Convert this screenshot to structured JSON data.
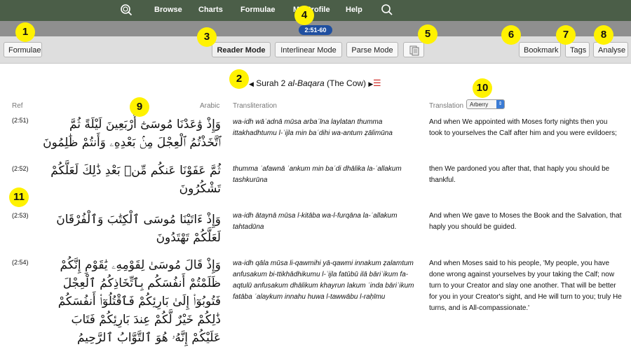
{
  "nav": {
    "items": [
      "Browse",
      "Charts",
      "Formulae",
      "My Profile",
      "Help"
    ],
    "verse_range": "2:51-60"
  },
  "toolbar": {
    "formulae": "Formulae",
    "reader_mode": "Reader Mode",
    "interlinear_mode": "Interlinear Mode",
    "parse_mode": "Parse Mode",
    "bookmark": "Bookmark",
    "tags": "Tags",
    "analyse": "Analyse"
  },
  "markers": [
    "1",
    "2",
    "3",
    "4",
    "5",
    "6",
    "7",
    "8",
    "9",
    "10",
    "11"
  ],
  "surah": {
    "prefix": "Surah 2",
    "name": "al-Baqara",
    "english": "(The Cow)"
  },
  "columns": {
    "ref": "Ref",
    "arabic": "Arabic",
    "transliteration": "Transliteration",
    "translation": "Translation"
  },
  "translator": "Arberry",
  "verses": [
    {
      "ref": "(2:51)",
      "arabic": "وَإِذْ وَٰعَدْنَا مُوسَىٰٓ أَرْبَعِينَ لَيْلَةً ثُمَّ ٱتَّخَذْتُمُ ٱلْعِجْلَ مِنۢ بَعْدِهِۦ وَأَنتُمْ ظَٰلِمُونَ",
      "translit": "wa-idh wāʿadnā mūsa arbaʿīna laylatan thumma ittakhadhtumu l-ʿijla min baʿdihi wa-antum ẓālimūna",
      "translation": "And when We appointed with Moses forty nights then you took to yourselves the Calf after him and you were evildoers;"
    },
    {
      "ref": "(2:52)",
      "arabic": "ثُمَّ عَفَوْنَا عَنكُم مِّنۢ بَعْدِ ذَٰلِكَ لَعَلَّكُمْ تَشْكُرُونَ",
      "translit": "thumma ʿafawnā ʿankum min baʿdi dhālika la-ʿallakum tashkurūna",
      "translation": "then We pardoned you after that, that haply you should be thankful."
    },
    {
      "ref": "(2:53)",
      "arabic": "وَإِذْ ءَاتَيْنَا مُوسَى ٱلْكِتَٰبَ وَٱلْفُرْقَانَ لَعَلَّكُمْ تَهْتَدُونَ",
      "translit": "wa-idh ātaynā mūsa l-kitāba wa-l-furqāna la-ʿallakum tahtadūna",
      "translation": "And when We gave to Moses the Book and the Salvation, that haply you should be guided."
    },
    {
      "ref": "(2:54)",
      "arabic": "وَإِذْ قَالَ مُوسَىٰ لِقَوْمِهِۦ يَٰقَوْمِ إِنَّكُمْ ظَلَمْتُمْ أَنفُسَكُم بِٱتِّخَاذِكُمُ ٱلْعِجْلَ فَتُوبُوٓا۟ إِلَىٰ بَارِئِكُمْ فَٱقْتُلُوٓا۟ أَنفُسَكُمْ ذَٰلِكُمْ خَيْرٌ لَّكُمْ عِندَ بَارِئِكُمْ فَتَابَ عَلَيْكُمْ إِنَّهُۥ هُوَ ٱلتَّوَّابُ ٱلرَّحِيمُ",
      "translit": "wa-idh qāla mūsa li-qawmihi yā-qawmi innakum ẓalamtum anfusakum bi-ttikhādhikumu l-ʿijla fatūbū ilā bāriʾikum fa-aqtulū anfusakum dhālikum khayrun lakum ʿinda bāriʾikum fatāba ʿalaykum innahu huwa l-tawwābu l-raḥīmu",
      "translation": "And when Moses said to his people, 'My people, you have done wrong against yourselves by your taking the Calf; now turn to your Creator and slay one another. That will be better for you in your Creator's sight, and He will turn to you; truly He turns, and is All-compassionate.'"
    }
  ]
}
